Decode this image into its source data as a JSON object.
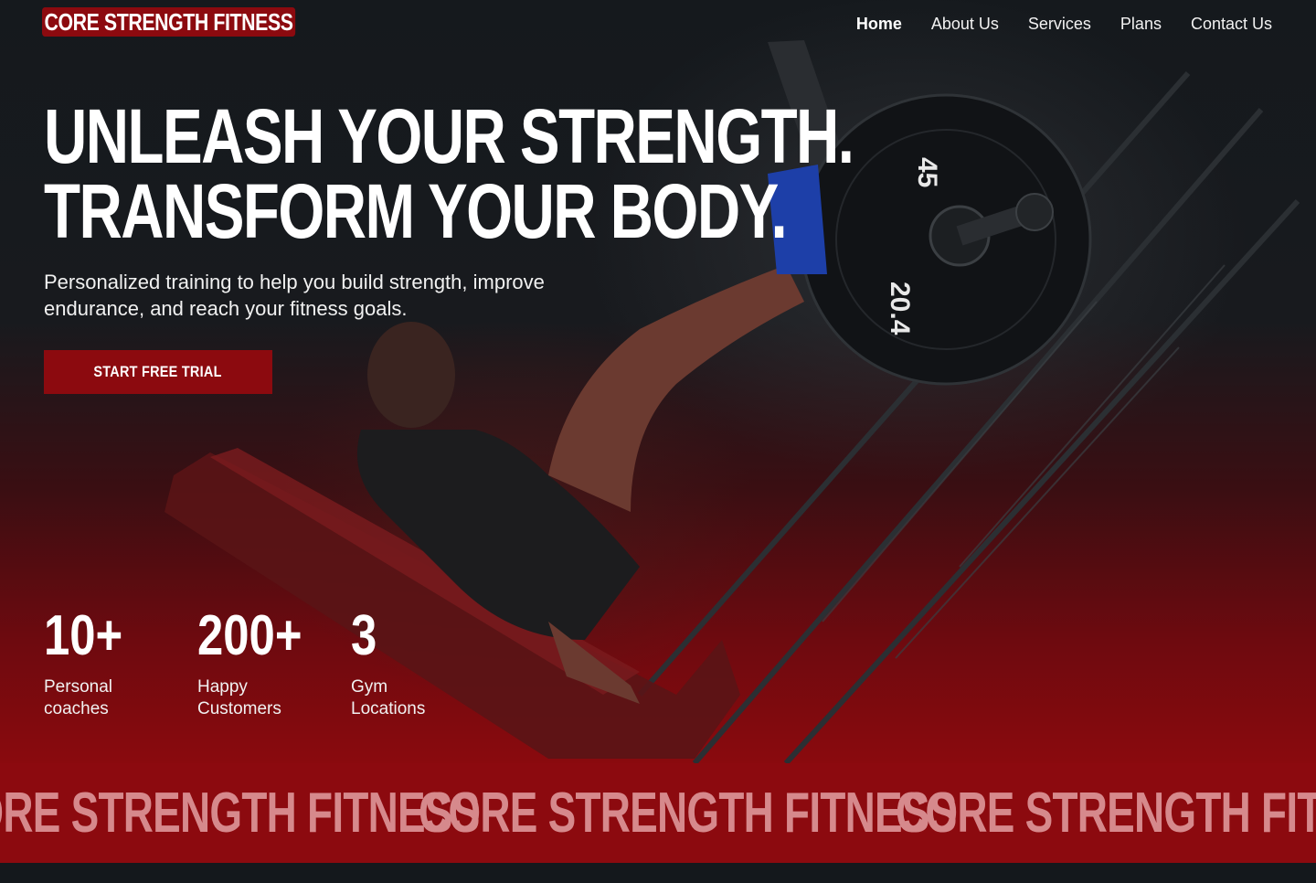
{
  "brand": {
    "logo_text": "CORE STRENGTH FITNESS"
  },
  "nav": {
    "items": [
      {
        "label": "Home",
        "active": true
      },
      {
        "label": "About Us",
        "active": false
      },
      {
        "label": "Services",
        "active": false
      },
      {
        "label": "Plans",
        "active": false
      },
      {
        "label": "Contact Us",
        "active": false
      }
    ]
  },
  "hero": {
    "headline_line1": "UNLEASH YOUR STRENGTH.",
    "headline_line2": "TRANSFORM YOUR BODY.",
    "subtitle": "Personalized training to help you build strength, improve endurance, and reach your fitness goals.",
    "cta_label": "START FREE TRIAL",
    "plate_weight": "45",
    "plate_kg": "20.4"
  },
  "stats": [
    {
      "value": "10+",
      "label": "Personal coaches"
    },
    {
      "value": "200+",
      "label": "Happy Customers"
    },
    {
      "value": "3",
      "label": "Gym Locations"
    }
  ],
  "marquee": {
    "text": "CORE STRENGTH FITNESS",
    "repeat": [
      "CORE STRENGTH FITNESS",
      "CORE STRENGTH FITNESS",
      "CORE STRENGTH FITNESS"
    ]
  },
  "colors": {
    "brand_red": "#8c0a0f",
    "background": "#14181c",
    "marquee_text": "#d6898c"
  }
}
